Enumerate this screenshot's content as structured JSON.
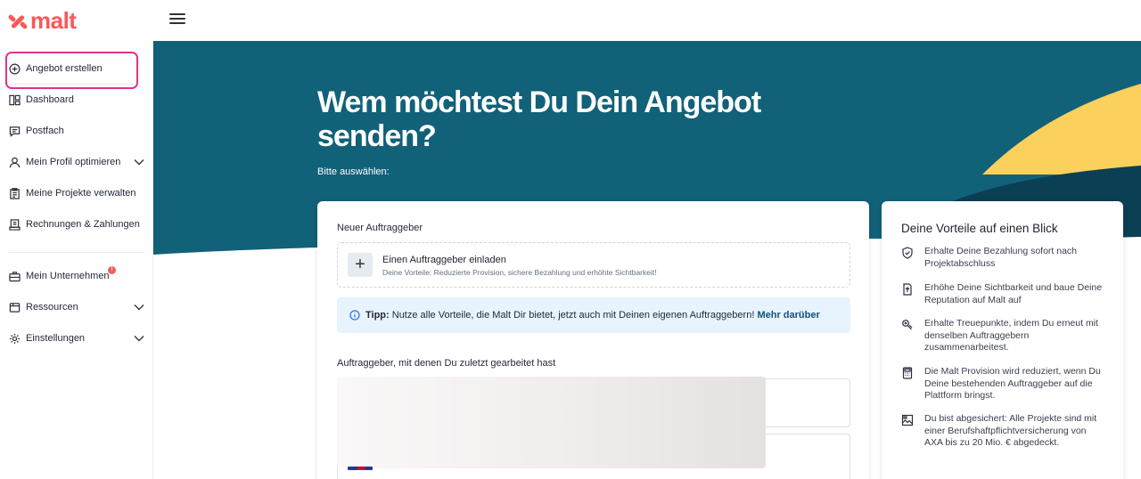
{
  "brand": {
    "name": "malt",
    "color": "#fc5757"
  },
  "sidebar": {
    "items": [
      {
        "label": "Angebot erstellen",
        "icon": "plus-circle-icon"
      },
      {
        "label": "Dashboard",
        "icon": "dashboard-icon"
      },
      {
        "label": "Postfach",
        "icon": "message-icon"
      },
      {
        "label": "Mein Profil optimieren",
        "icon": "user-icon"
      },
      {
        "label": "Meine Projekte verwalten",
        "icon": "clipboard-icon"
      },
      {
        "label": "Rechnungen & Zahlungen",
        "icon": "receipt-icon"
      },
      {
        "label": "Mein Unternehmen",
        "icon": "briefcase-icon",
        "badge": "!"
      },
      {
        "label": "Ressourcen",
        "icon": "book-icon"
      },
      {
        "label": "Einstellungen",
        "icon": "gear-icon"
      }
    ]
  },
  "hero": {
    "title": "Wem möchtest Du Dein Angebot senden?",
    "subtitle": "Bitte auswählen:",
    "colors": {
      "teal": "#116179",
      "dark": "#0b3f54",
      "yellow": "#fbd05c"
    }
  },
  "main": {
    "new_client_heading": "Neuer Auftraggeber",
    "invite_title": "Einen Auftraggeber einladen",
    "invite_desc": "Deine Vorteile: Reduzierte Provision, sichere Bezahlung und erhöhte Sichtbarkeit!",
    "tip_label": "Tipp:",
    "tip_text": "Nutze alle Vorteile, die Malt Dir bietet, jetzt auch mit Deinen eigenen Auftraggebern!",
    "tip_link": "Mehr darüber",
    "recent_heading": "Auftraggeber, mit denen Du zuletzt gearbeitet hast"
  },
  "benefits": {
    "heading": "Deine Vorteile auf einen Blick",
    "items": [
      {
        "text": "Erhalte Deine Bezahlung sofort nach Projektabschluss",
        "icon": "shield-check-icon"
      },
      {
        "text": "Erhöhe Deine Sichtbarkeit und baue Deine Reputation auf Malt auf",
        "icon": "document-arrow-icon"
      },
      {
        "text": "Erhalte Treuepunkte, indem Du erneut mit denselben Auftraggebern zusammenarbeitest.",
        "icon": "handshake-icon"
      },
      {
        "text": "Die Malt Provision wird reduziert, wenn Du Deine bestehenden Auftraggeber auf die Plattform bringst.",
        "icon": "calculator-icon"
      },
      {
        "text": "Du bist abgesichert: Alle Projekte sind mit einer Berufshaftpflichtversicherung von AXA bis zu 20 Mio. € abgedeckt.",
        "icon": "insurance-icon"
      }
    ]
  }
}
